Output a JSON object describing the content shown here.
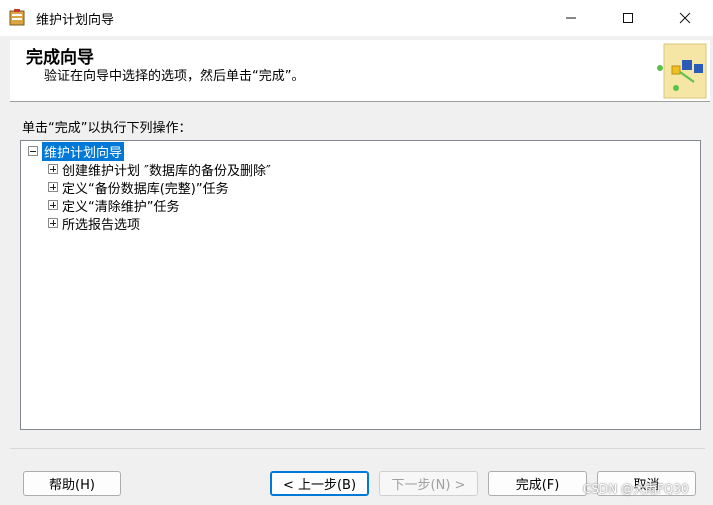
{
  "window": {
    "title": "维护计划向导"
  },
  "header": {
    "title": "完成向导",
    "subtitle": "验证在向导中选择的选项，然后单击“完成”。"
  },
  "instruction": "单击“完成”以执行下列操作：",
  "tree": {
    "root": "维护计划向导",
    "items": [
      {
        "label": "创建维护计划 ″数据库的备份及删除″"
      },
      {
        "label": "定义“备份数据库(完整)”任务"
      },
      {
        "label": "定义“清除维护”任务"
      },
      {
        "label": "所选报告选项"
      }
    ]
  },
  "buttons": {
    "help": "帮助(H)",
    "back": "< 上一步(B)",
    "next": "下一步(N) >",
    "finish": "完成(F)",
    "cancel": "取消"
  },
  "watermark": "CSDN @大雨FQ30"
}
